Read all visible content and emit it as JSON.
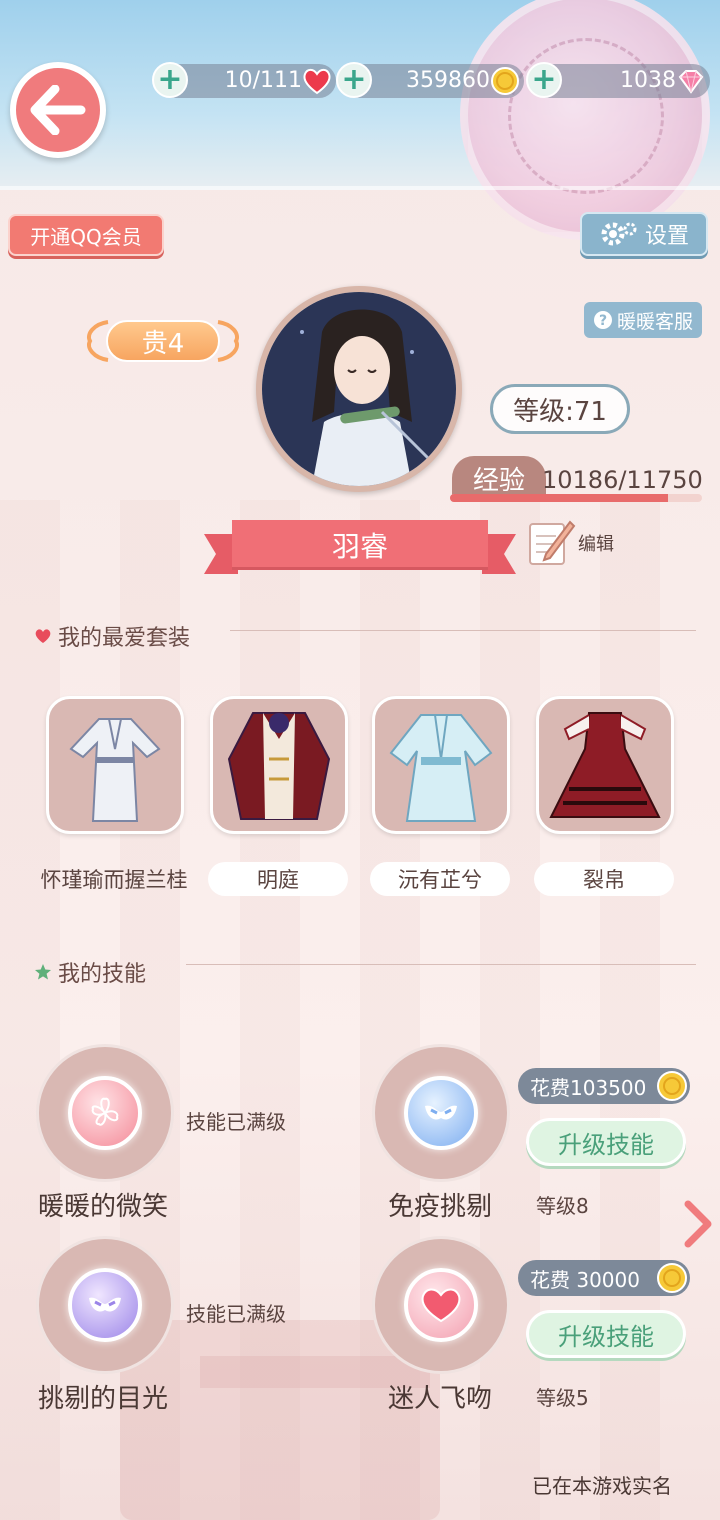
{
  "resources": {
    "stamina": "10/111",
    "gold": "359860",
    "diamonds": "1038"
  },
  "buttons": {
    "qq_member": "开通QQ会员",
    "settings": "设置",
    "customer_service": "暖暖客服",
    "edit": "编辑"
  },
  "profile": {
    "vip": "贵4",
    "level": "等级:71",
    "exp_label": "经验",
    "exp_value": "10186/11750",
    "exp_fraction": 0.867,
    "name": "羽睿"
  },
  "favorites": {
    "title": "我的最爱套装",
    "outfits": [
      {
        "name": "怀瑾瑜而握兰桂"
      },
      {
        "name": "明庭"
      },
      {
        "name": "沅有芷兮"
      },
      {
        "name": "裂帛"
      }
    ]
  },
  "skills": {
    "title": "我的技能",
    "items": [
      {
        "name": "暖暖的微笑",
        "status": "技能已满级"
      },
      {
        "name": "免疫挑剔",
        "cost": "花费103500",
        "upgrade": "升级技能",
        "level": "等级8"
      },
      {
        "name": "挑剔的目光",
        "status": "技能已满级"
      },
      {
        "name": "迷人飞吻",
        "cost": "花费  30000",
        "upgrade": "升级技能",
        "level": "等级5"
      }
    ]
  },
  "footer": {
    "realname": "已在本游戏实名"
  },
  "colors": {
    "accent": "#f06f76",
    "green": "#4aa07a",
    "slate": "#7d8999"
  }
}
